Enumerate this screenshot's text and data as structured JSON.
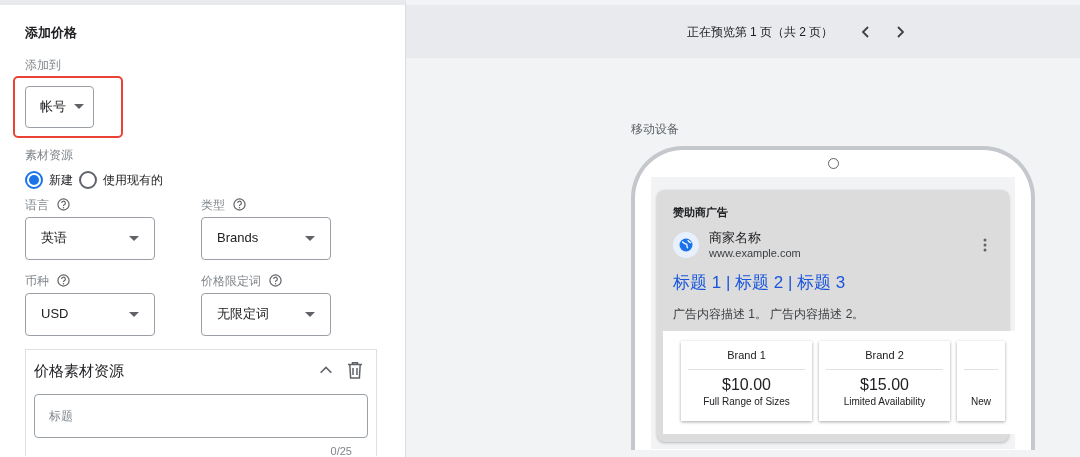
{
  "form": {
    "title": "添加价格",
    "add_to": {
      "label": "添加到",
      "value": "帐号",
      "highlighted": true
    },
    "asset_source": {
      "label": "素材资源",
      "options": [
        {
          "label": "新建",
          "selected": true
        },
        {
          "label": "使用现有的",
          "selected": false
        }
      ]
    },
    "selects": [
      {
        "label": "语言",
        "value": "英语"
      },
      {
        "label": "类型",
        "value": "Brands"
      },
      {
        "label": "币种",
        "value": "USD"
      },
      {
        "label": "价格限定词",
        "value": "无限定词"
      }
    ],
    "price_asset": {
      "title": "价格素材资源",
      "expanded": true,
      "header_field": {
        "placeholder": "标题",
        "counter": "0/25"
      }
    }
  },
  "preview": {
    "pager": "正在预览第 1 页（共 2 页）",
    "device_label": "移动设备",
    "ad": {
      "sponsored": "赞助商广告",
      "business": "商家名称",
      "url": "www.example.com",
      "headline": "标题 1 | 标题 2 | 标题 3",
      "description": "广告内容描述 1。 广告内容描述 2。",
      "items": [
        {
          "header": "Brand 1",
          "price": "$10.00",
          "description": "Full Range of Sizes"
        },
        {
          "header": "Brand 2",
          "price": "$15.00",
          "description": "Limited Availability"
        },
        {
          "description": "New"
        }
      ]
    }
  }
}
